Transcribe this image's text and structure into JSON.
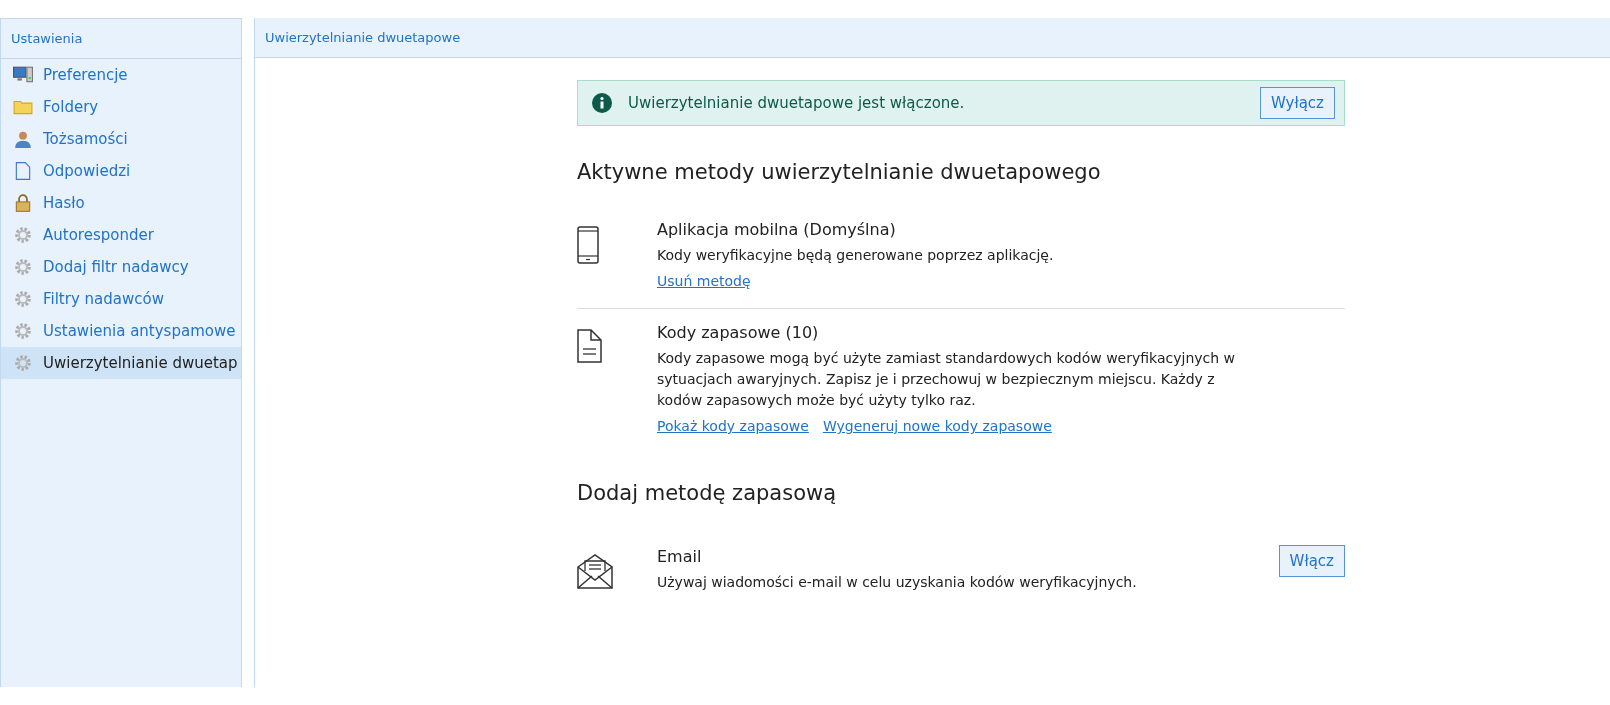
{
  "sidebar": {
    "title": "Ustawienia",
    "items": [
      {
        "label": "Preferencje",
        "kind": "monitor",
        "selected": false
      },
      {
        "label": "Foldery",
        "kind": "folder",
        "selected": false
      },
      {
        "label": "Tożsamości",
        "kind": "person",
        "selected": false
      },
      {
        "label": "Odpowiedzi",
        "kind": "document",
        "selected": false
      },
      {
        "label": "Hasło",
        "kind": "lock",
        "selected": false
      },
      {
        "label": "Autoresponder",
        "kind": "gear",
        "selected": false
      },
      {
        "label": "Dodaj filtr nadawcy",
        "kind": "gear",
        "selected": false
      },
      {
        "label": "Filtry nadawców",
        "kind": "gear",
        "selected": false
      },
      {
        "label": "Ustawienia antyspamowe",
        "kind": "gear",
        "selected": false
      },
      {
        "label": "Uwierzytelnianie dwuetap",
        "kind": "gear",
        "selected": true
      }
    ]
  },
  "main": {
    "title": "Uwierzytelnianie dwuetapowe",
    "notice": {
      "text": "Uwierzytelnianie dwuetapowe jest włączone.",
      "button": "Wyłącz"
    },
    "active_heading": "Aktywne metody uwierzytelnianie dwuetapowego",
    "active_methods": [
      {
        "kind": "phone",
        "title": "Aplikacja mobilna (Domyślna)",
        "description": "Kody weryfikacyjne będą generowane poprzez aplikację.",
        "links": [
          "Usuń metodę"
        ]
      },
      {
        "kind": "document",
        "title": "Kody zapasowe (10)",
        "description": "Kody zapasowe mogą być użyte zamiast standardowych kodów weryfikacyjnych w sytuacjach awaryjnych. Zapisz je i przechowuj w bezpiecznym miejscu. Każdy z kodów zapasowych może być użyty tylko raz.",
        "links": [
          "Pokaż kody zapasowe",
          "Wygeneruj nowe kody zapasowe"
        ]
      }
    ],
    "add_heading": "Dodaj metodę zapasową",
    "add_methods": [
      {
        "kind": "email",
        "title": "Email",
        "description": "Używaj wiadomości e-mail w celu uzyskania kodów weryfikacyjnych.",
        "button": "Włącz"
      }
    ]
  }
}
